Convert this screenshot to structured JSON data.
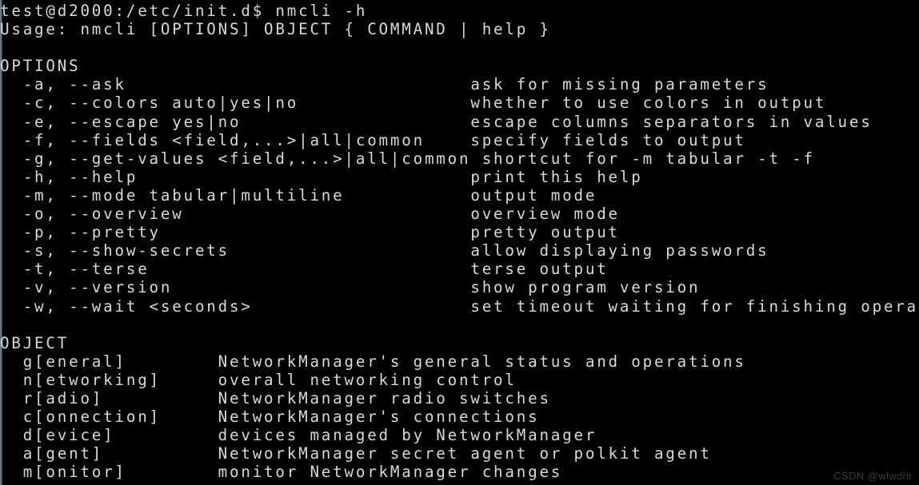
{
  "terminal": {
    "background_color": "#000000",
    "text_color": "#d6d9de",
    "prompt_line": "test@d2000:/etc/init.d$ nmcli -h",
    "usage_line": "Usage: nmcli [OPTIONS] OBJECT { COMMAND | help }",
    "blank": ""
  },
  "options_section": {
    "heading": "OPTIONS",
    "key_column_width": 39,
    "key_indent": 2,
    "rows": [
      {
        "key": "-a, --ask",
        "desc": "ask for missing parameters"
      },
      {
        "key": "-c, --colors auto|yes|no",
        "desc": "whether to use colors in output"
      },
      {
        "key": "-e, --escape yes|no",
        "desc": "escape columns separators in values"
      },
      {
        "key": "-f, --fields <field,...>|all|common",
        "desc": "specify fields to output"
      },
      {
        "key": "-g, --get-values <field,...>|all|common",
        "desc": "shortcut for -m tabular -t -f"
      },
      {
        "key": "-h, --help",
        "desc": "print this help"
      },
      {
        "key": "-m, --mode tabular|multiline",
        "desc": "output mode"
      },
      {
        "key": "-o, --overview",
        "desc": "overview mode"
      },
      {
        "key": "-p, --pretty",
        "desc": "pretty output"
      },
      {
        "key": "-s, --show-secrets",
        "desc": "allow displaying passwords"
      },
      {
        "key": "-t, --terse",
        "desc": "terse output"
      },
      {
        "key": "-v, --version",
        "desc": "show program version"
      },
      {
        "key": "-w, --wait <seconds>",
        "desc": "set timeout waiting for finishing operations"
      }
    ]
  },
  "object_section": {
    "heading": "OBJECT",
    "key_column_width": 17,
    "key_indent": 2,
    "rows": [
      {
        "key": "g[eneral]",
        "desc": "NetworkManager's general status and operations"
      },
      {
        "key": "n[etworking]",
        "desc": "overall networking control"
      },
      {
        "key": "r[adio]",
        "desc": "NetworkManager radio switches"
      },
      {
        "key": "c[onnection]",
        "desc": "NetworkManager's connections"
      },
      {
        "key": "d[evice]",
        "desc": "devices managed by NetworkManager"
      },
      {
        "key": "a[gent]",
        "desc": "NetworkManager secret agent or polkit agent"
      },
      {
        "key": "m[onitor]",
        "desc": "monitor NetworkManager changes"
      }
    ]
  },
  "watermark": {
    "text": "CSDN @wlwdhr",
    "color": "#3a3a3a"
  }
}
